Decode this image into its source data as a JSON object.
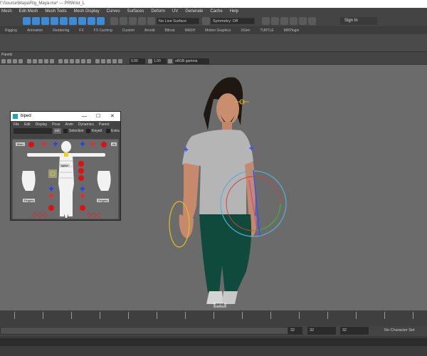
{
  "window": {
    "title": "f:\\Source\\Maya\\Rig_Maya.ma* --- PRWrist_L"
  },
  "menubar": {
    "items": [
      "Mesh",
      "Edit Mesh",
      "Mesh Tools",
      "Mesh Display",
      "Curves",
      "Surfaces",
      "Deform",
      "UV",
      "Generate",
      "Cache",
      "Help"
    ]
  },
  "statusline": {
    "live_surface": "No Live Surface",
    "symmetry": "Symmetry: Off",
    "sign_in": "Sign In"
  },
  "shelf_tabs": [
    "Rigging",
    "Animation",
    "Rendering",
    "FX",
    "FX Caching",
    "Custom",
    "Arnold",
    "Bifrost",
    "MASH",
    "Motion Graphics",
    "XGen",
    "TURTLE",
    "MRPlugin"
  ],
  "panels": {
    "label": "Panels",
    "field_a": "0.00",
    "field_b": "1.00",
    "color_space": "sRGB gamma"
  },
  "viewport": {
    "camera_label": "persp"
  },
  "range": {
    "start_value": "32",
    "field_1": "32",
    "field_2": "32",
    "character_set": "No Character Set"
  },
  "biped": {
    "title": "biped",
    "controls": {
      "minimize": "—",
      "maximize": "☐",
      "close": "✕"
    },
    "menu": [
      "File",
      "Edit",
      "Display",
      "Pose",
      "Anim",
      "Dynamics",
      "Parent"
    ],
    "toolbar": {
      "set_label": "set",
      "selection_label": "Selection",
      "keyed_label": "Keyed",
      "extra_label": "Extra"
    },
    "labels": {
      "main": "Main",
      "all": "All",
      "spine": "spine",
      "fingers_left": "Fingers",
      "fingers_right": "Fingers"
    }
  }
}
